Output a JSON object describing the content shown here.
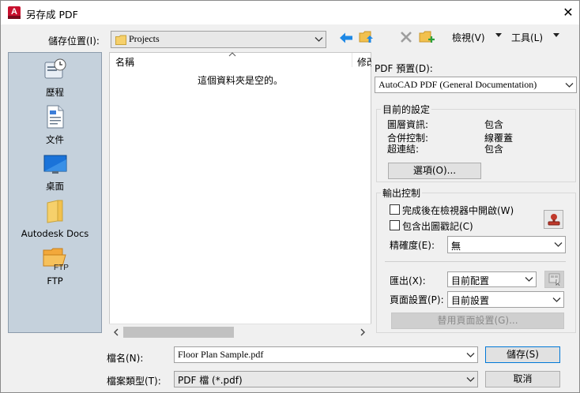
{
  "window": {
    "title": "另存成 PDF"
  },
  "save_in": {
    "label": "儲存位置(I):",
    "value": "Projects"
  },
  "toolbar": {
    "views_label": "檢視(V)",
    "tools_label": "工具(L)"
  },
  "places": [
    {
      "label": "歷程"
    },
    {
      "label": "文件"
    },
    {
      "label": "桌面"
    },
    {
      "label": "Autodesk Docs"
    },
    {
      "label": "FTP"
    }
  ],
  "file_list": {
    "column_name": "名稱",
    "column_modified": "修改",
    "empty_text": "這個資料夾是空的。"
  },
  "pdf_preset": {
    "label": "PDF 預置(D):",
    "value": "AutoCAD PDF (General Documentation)"
  },
  "current_settings": {
    "title": "目前的設定",
    "rows": [
      {
        "name": "圖層資訊:",
        "value": "包含"
      },
      {
        "name": "合併控制:",
        "value": "線覆蓋"
      },
      {
        "name": "超連結:",
        "value": "包含"
      }
    ],
    "options_button": "選項(O)..."
  },
  "output_controls": {
    "title": "輸出控制",
    "open_in_viewer": "完成後在檢視器中開啟(W)",
    "include_plot_stamp": "包含出圖戳記(C)",
    "precision_label": "精確度(E):",
    "precision_value": "無",
    "export_label": "匯出(X):",
    "export_value": "目前配置",
    "page_setup_label": "頁面設置(P):",
    "page_setup_value": "目前設置",
    "override_button": "替用頁面設置(G)..."
  },
  "file_name": {
    "label": "檔名(N):",
    "value": "Floor Plan Sample.pdf"
  },
  "file_type": {
    "label": "檔案類型(T):",
    "value": "PDF 檔 (*.pdf)"
  },
  "buttons": {
    "save": "儲存(S)",
    "cancel": "取消"
  },
  "colors": {
    "accent_blue": "#1e88e5",
    "folder_yellow": "#f2c14e",
    "places_bg": "#c5d1dc",
    "brand_red": "#c8102e"
  }
}
